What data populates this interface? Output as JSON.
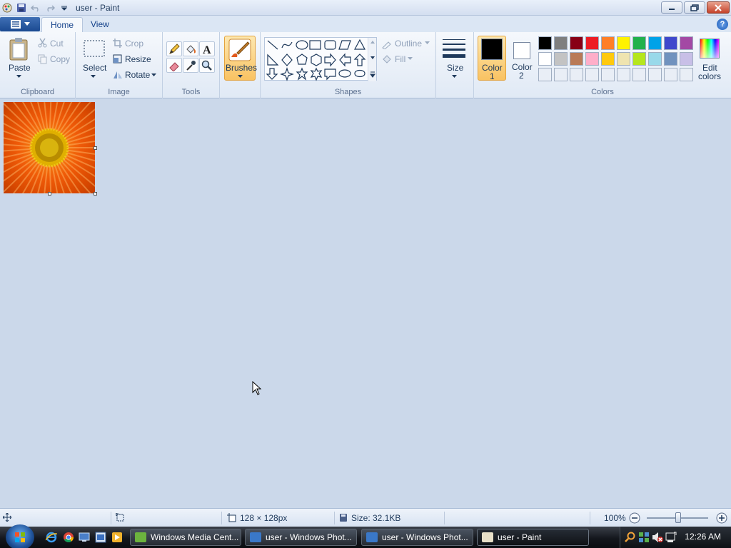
{
  "window": {
    "title": "user - Paint"
  },
  "tabs": [
    {
      "label": "Home"
    },
    {
      "label": "View"
    }
  ],
  "ribbon": {
    "clipboard": {
      "group_label": "Clipboard",
      "paste": "Paste",
      "cut": "Cut",
      "copy": "Copy"
    },
    "image": {
      "group_label": "Image",
      "select": "Select",
      "crop": "Crop",
      "resize": "Resize",
      "rotate": "Rotate"
    },
    "tools": {
      "group_label": "Tools"
    },
    "brushes": {
      "label": "Brushes"
    },
    "shapes": {
      "group_label": "Shapes",
      "outline": "Outline",
      "fill": "Fill"
    },
    "size": {
      "label": "Size"
    },
    "colors": {
      "group_label": "Colors",
      "color1_line1": "Color",
      "color1_line2": "1",
      "color2_line1": "Color",
      "color2_line2": "2",
      "edit_line1": "Edit",
      "edit_line2": "colors",
      "color1_value": "#000000",
      "color2_value": "#ffffff",
      "palette_row1": [
        "#000000",
        "#7f7f7f",
        "#880015",
        "#ed1c24",
        "#ff7f27",
        "#fff200",
        "#22b14c",
        "#00a2e8",
        "#3f48cc",
        "#a349a4"
      ],
      "palette_row2": [
        "#ffffff",
        "#c3c3c3",
        "#b97a57",
        "#ffaec9",
        "#ffc90e",
        "#efe4b0",
        "#b5e61d",
        "#99d9ea",
        "#7092be",
        "#c8bfe7"
      ]
    }
  },
  "status": {
    "image_size": "128 × 128px",
    "file_size": "Size: 32.1KB",
    "zoom": "100%"
  },
  "taskbar": {
    "tasks": [
      {
        "label": "Windows Media Cent..."
      },
      {
        "label": "user - Windows Phot..."
      },
      {
        "label": "user - Windows Phot..."
      },
      {
        "label": "user - Paint"
      }
    ],
    "clock": "12:26 AM"
  }
}
